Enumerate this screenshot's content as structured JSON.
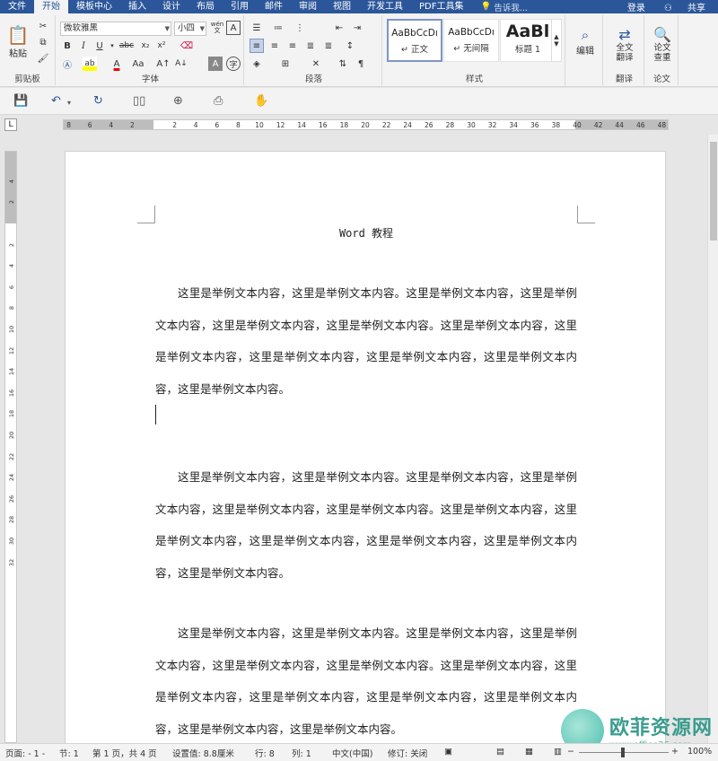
{
  "tabs": [
    "文件",
    "开始",
    "模板中心",
    "插入",
    "设计",
    "布局",
    "引用",
    "邮件",
    "审阅",
    "视图",
    "开发工具",
    "PDF工具集"
  ],
  "tell_me": "告诉我...",
  "login": "登录",
  "share": "共享",
  "ribbon": {
    "clipboard": {
      "paste": "粘贴",
      "label": "剪贴板"
    },
    "font": {
      "name": "微软雅黑",
      "size": "小四",
      "label": "字体",
      "wen": "wén"
    },
    "paragraph": {
      "label": "段落"
    },
    "styles": {
      "label": "样式",
      "items": [
        {
          "sample": "AaBbCcDı",
          "name": "↵ 正文"
        },
        {
          "sample": "AaBbCcDı",
          "name": "↵ 无间隔"
        },
        {
          "sample": "AaBl",
          "name": "标题 1"
        }
      ]
    },
    "edit": {
      "label": "编辑"
    },
    "translate": {
      "btn": "全文翻译",
      "label": "翻译"
    },
    "paper": {
      "btn": "论文查重",
      "label": "论文"
    }
  },
  "ruler": {
    "h_ticks": [
      "8",
      "6",
      "4",
      "2",
      "2",
      "4",
      "6",
      "8",
      "10",
      "12",
      "14",
      "16",
      "18",
      "20",
      "22",
      "24",
      "26",
      "28",
      "30",
      "32",
      "34",
      "36",
      "38",
      "40",
      "42",
      "44",
      "46",
      "48"
    ],
    "v_ticks": [
      "4",
      "2",
      "2",
      "4",
      "6",
      "8",
      "10",
      "12",
      "14",
      "16",
      "18",
      "20",
      "22",
      "24",
      "26",
      "28",
      "30",
      "32"
    ]
  },
  "document": {
    "title": "Word 教程",
    "paragraphs": [
      "这里是举例文本内容，这里是举例文本内容。这里是举例文本内容，这里是举例文本内容，这里是举例文本内容，这里是举例文本内容。这里是举例文本内容，这里是举例文本内容，这里是举例文本内容，这里是举例文本内容，这里是举例文本内容，这里是举例文本内容。",
      "这里是举例文本内容，这里是举例文本内容。这里是举例文本内容，这里是举例文本内容，这里是举例文本内容，这里是举例文本内容。这里是举例文本内容，这里是举例文本内容，这里是举例文本内容，这里是举例文本内容，这里是举例文本内容，这里是举例文本内容。",
      "这里是举例文本内容，这里是举例文本内容。这里是举例文本内容，这里是举例文本内容，这里是举例文本内容，这里是举例文本内容。这里是举例文本内容，这里是举例文本内容，这里是举例文本内容，这里是举例文本内容，这里是举例文本内容，这里是举例文本内容，这里是举例文本内容。"
    ]
  },
  "status": {
    "page": "页面: - 1 -",
    "section": "节: 1",
    "pages": "第 1 页，共 4 页",
    "setting": "设置值: 8.8厘米",
    "row": "行: 8",
    "col": "列: 1",
    "lang": "中文(中国)",
    "track": "修订: 关闭",
    "zoom": "100%"
  },
  "watermark": {
    "cn": "欧菲资源网",
    "url": "www.office26.com"
  }
}
